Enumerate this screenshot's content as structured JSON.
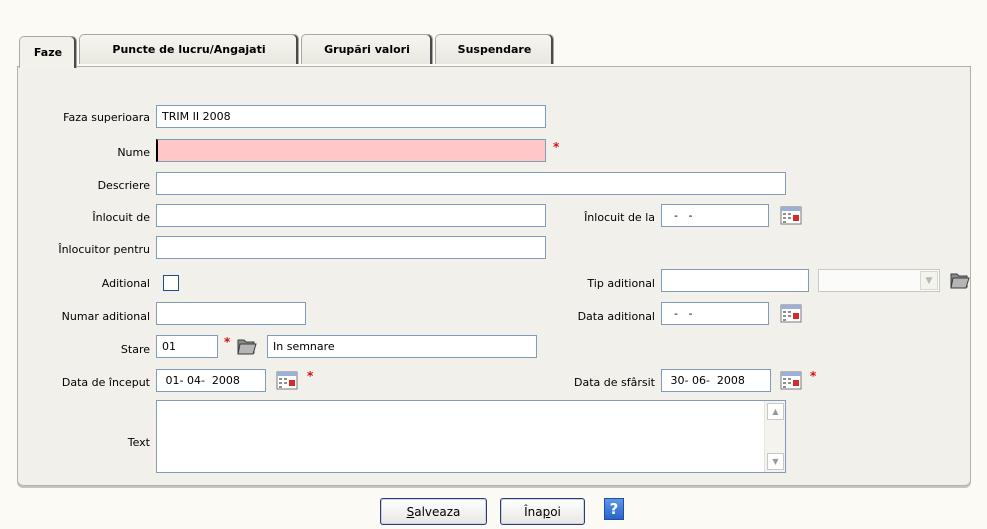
{
  "tabs": [
    {
      "label": "Faze",
      "active": true
    },
    {
      "label": "Puncte de lucru/Angajati",
      "active": false
    },
    {
      "label": "Grupări valori",
      "active": false
    },
    {
      "label": "Suspendare",
      "active": false
    }
  ],
  "form": {
    "faza_superioara": {
      "label": "Faza superioara",
      "value": "TRIM II 2008"
    },
    "nume": {
      "label": "Nume",
      "value": ""
    },
    "descriere": {
      "label": "Descriere",
      "value": ""
    },
    "inlocuit_de": {
      "label": "Înlocuit de",
      "value": ""
    },
    "inlocuit_de_la": {
      "label": "Înlocuit de la",
      "value": "  -   -  "
    },
    "inlocuitor_pentru": {
      "label": "Înlocuitor pentru",
      "value": ""
    },
    "aditional": {
      "label": "Aditional",
      "checked": false
    },
    "tip_aditional": {
      "label": "Tip aditional",
      "value": "",
      "select_value": ""
    },
    "numar_aditional": {
      "label": "Numar aditional",
      "value": ""
    },
    "data_aditional": {
      "label": "Data aditional",
      "value": "  -   -  "
    },
    "stare": {
      "label": "Stare",
      "code": "01",
      "name": "In semnare"
    },
    "data_inceput": {
      "label": "Data de început",
      "value": " 01- 04-  2008"
    },
    "data_sfarsit": {
      "label": "Data de sfârsit",
      "value": " 30- 06-  2008"
    },
    "text": {
      "label": "Text",
      "value": ""
    },
    "required_mark": "*"
  },
  "buttons": {
    "save_prefix": "S",
    "save_rest": "alveaza",
    "back_prefix": "Îna",
    "back_accel": "p",
    "back_rest": "oi",
    "help_label": "?"
  },
  "colors": {
    "required_bg": "#ffc7c7",
    "panel_bg": "#f1f0ea",
    "accent": "#2a63c9"
  }
}
